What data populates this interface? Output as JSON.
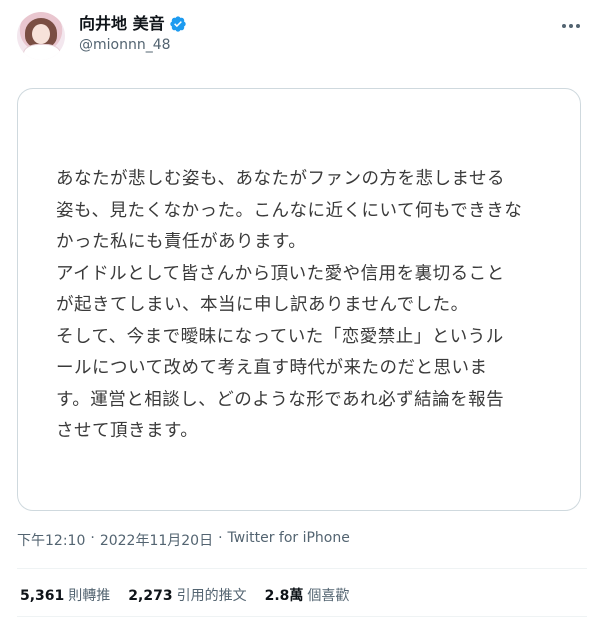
{
  "author": {
    "display_name": "向井地 美音",
    "handle": "@mionnn_48",
    "verified_icon": "verified-badge-icon",
    "avatar_icon": "profile-avatar"
  },
  "tweet": {
    "statement_lines": [
      "あなたが悲しむ姿も、あなたがファンの方を悲しませる",
      "姿も、見たくなかった。こんなに近くにいて何もでききな",
      "かった私にも責任があります。",
      "アイドルとして皆さんから頂いた愛や信用を裏切ること",
      "が起きてしまい、本当に申し訳ありませんでした。",
      "そして、今まで曖昧になっていた「恋愛禁止」というル",
      "ールについて改めて考え直す時代が来たのだと思いま",
      "す。運営と相談し、どのような形であれ必ず結論を報告",
      "させて頂きます。"
    ],
    "time": "下午12:10",
    "separator": "·",
    "date": "2022年11月20日",
    "source": "Twitter for iPhone"
  },
  "stats": {
    "retweets_count": "5,361",
    "retweets_label": "則轉推",
    "quotes_count": "2,273",
    "quotes_label": "引用的推文",
    "likes_count": "2.8萬",
    "likes_label": "個喜歡"
  },
  "colors": {
    "verified_blue": "#1d9bf0",
    "secondary_text": "#536471",
    "border": "#cfd9de"
  }
}
